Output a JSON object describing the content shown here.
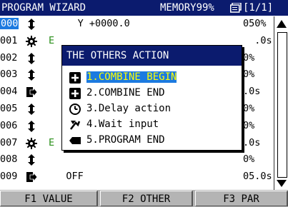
{
  "header": {
    "title": "PROGRAM WIZARD",
    "memory": "MEMORY99%",
    "page": "[1/1]"
  },
  "program": {
    "rows": [
      {
        "line": "000",
        "icon": "up-down-arrow-icon",
        "command": "     Y +0000.0",
        "value": "050%"
      },
      {
        "line": "001",
        "icon": "gear-icon",
        "command": "E",
        "value": "  .0s"
      },
      {
        "line": "002",
        "icon": "up-down-arrow-icon",
        "command": "",
        "value": "0%"
      },
      {
        "line": "003",
        "icon": "up-down-arrow-icon",
        "command": "",
        "value": "0%"
      },
      {
        "line": "004",
        "icon": "enter-icon",
        "command": "",
        "value": ".0s"
      },
      {
        "line": "005",
        "icon": "up-down-arrow-icon",
        "command": "",
        "value": "0%"
      },
      {
        "line": "006",
        "icon": "up-down-arrow-icon",
        "command": "",
        "value": "0%"
      },
      {
        "line": "007",
        "icon": "gear-icon",
        "command": "E",
        "value": ".0s"
      },
      {
        "line": "008",
        "icon": "up-down-arrow-icon",
        "command": "",
        "value": "0%"
      },
      {
        "line": "009",
        "icon": "enter-icon",
        "command": "   OFF",
        "value": "05.0s"
      }
    ]
  },
  "dialog": {
    "title": "THE OTHERS ACTION",
    "items": [
      {
        "icon": "plus-box-icon",
        "label": "1.COMBINE BEGIN"
      },
      {
        "icon": "plus-box-icon",
        "label": "2.COMBINE END"
      },
      {
        "icon": "clock-icon",
        "label": "3.Delay action"
      },
      {
        "icon": "wait-input-icon",
        "label": "4.Wait input"
      },
      {
        "icon": "program-end-icon",
        "label": "5.PROGRAM END"
      }
    ]
  },
  "footer": {
    "f1": "F1 VALUE",
    "f2": "F2 OTHER",
    "f3": "F3 PAR"
  },
  "colors": {
    "header_bg": "#0b1b6e",
    "selection": "#1c7ae0",
    "highlight_text": "#ffff00",
    "green_text": "#2a8f1a"
  }
}
